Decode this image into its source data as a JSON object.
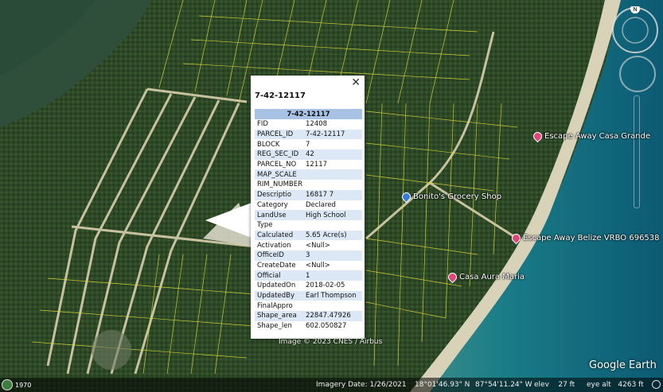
{
  "popup": {
    "title": "7-42-12117",
    "close_label": "✕",
    "table_header": "7-42-12117",
    "rows": [
      {
        "key": "FID",
        "value": "12408"
      },
      {
        "key": "PARCEL_ID",
        "value": "7-42-12117"
      },
      {
        "key": "BLOCK",
        "value": "7"
      },
      {
        "key": "REG_SEC_ID",
        "value": "42"
      },
      {
        "key": "PARCEL_NO",
        "value": "12117"
      },
      {
        "key": "MAP_SCALE",
        "value": ""
      },
      {
        "key": "RIM_NUMBER",
        "value": ""
      },
      {
        "key": "Descriptio",
        "value": "16817 7"
      },
      {
        "key": "Category",
        "value": "Declared"
      },
      {
        "key": "LandUse",
        "value": "High School"
      },
      {
        "key": "Type",
        "value": ""
      },
      {
        "key": "Calculated",
        "value": "5.65 Acre(s)"
      },
      {
        "key": "Activation",
        "value": "<Null>"
      },
      {
        "key": "OfficeID",
        "value": "3"
      },
      {
        "key": "CreateDate",
        "value": "<Null>"
      },
      {
        "key": "Official",
        "value": "1"
      },
      {
        "key": "UpdatedOn",
        "value": "2018-02-05"
      },
      {
        "key": "UpdatedBy",
        "value": "Earl Thompson"
      },
      {
        "key": "FinalAppro",
        "value": ""
      },
      {
        "key": "Shape_area",
        "value": "22847.47926"
      },
      {
        "key": "Shape_len",
        "value": "602.050827"
      }
    ]
  },
  "places": {
    "casa_grande": "Escape Away Casa Grande",
    "grocery": "Bonito's Grocery Shop",
    "vrbo": "Escape Away Belize VRBO 696538",
    "casa_aura": "Casa Aura Maria"
  },
  "credit": "Image © 2023 CNES / Airbus",
  "status": {
    "year": "1970",
    "imagery_date": "Imagery Date: 1/26/2021",
    "lat": "18°01'46.93\" N",
    "lon": "87°54'11.24\" W",
    "elev": "elev    27 ft",
    "eye_alt": "eye alt   4263 ft"
  },
  "brand": "Google Earth",
  "compass_label": "N",
  "colors": {
    "parcel_lines": "#e8e23a",
    "header_row": "#a8c2e6",
    "alt_row": "#dde8f6",
    "pin_pink": "#e0457b",
    "pin_blue": "#3a7bd5"
  }
}
